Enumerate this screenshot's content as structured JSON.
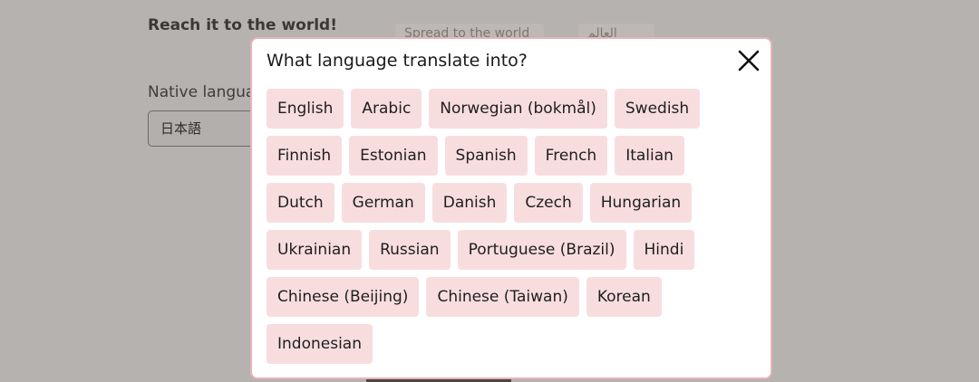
{
  "background": {
    "title": "Reach it to the world!",
    "chip_one": "Spread to the world",
    "chip_two": "العالم",
    "native_language_label": "Native language",
    "native_language_value": "日本語"
  },
  "modal": {
    "title": "What language translate into?",
    "close_icon": "close-icon",
    "rows": [
      [
        "English",
        "Arabic",
        "Norwegian (bokmål)",
        "Swedish"
      ],
      [
        "Finnish",
        "Estonian",
        "Spanish",
        "French",
        "Italian"
      ],
      [
        "Dutch",
        "German",
        "Danish",
        "Czech",
        "Hungarian"
      ],
      [
        "Ukrainian",
        "Russian",
        "Portuguese (Brazil)",
        "Hindi"
      ],
      [
        "Chinese (Beijing)",
        "Chinese (Taiwan)",
        "Korean"
      ],
      [
        "Indonesian"
      ]
    ]
  },
  "colors": {
    "overlay": "#b6b2af",
    "modal_border": "#e8b3b6",
    "chip_bg": "#f8dddf"
  }
}
